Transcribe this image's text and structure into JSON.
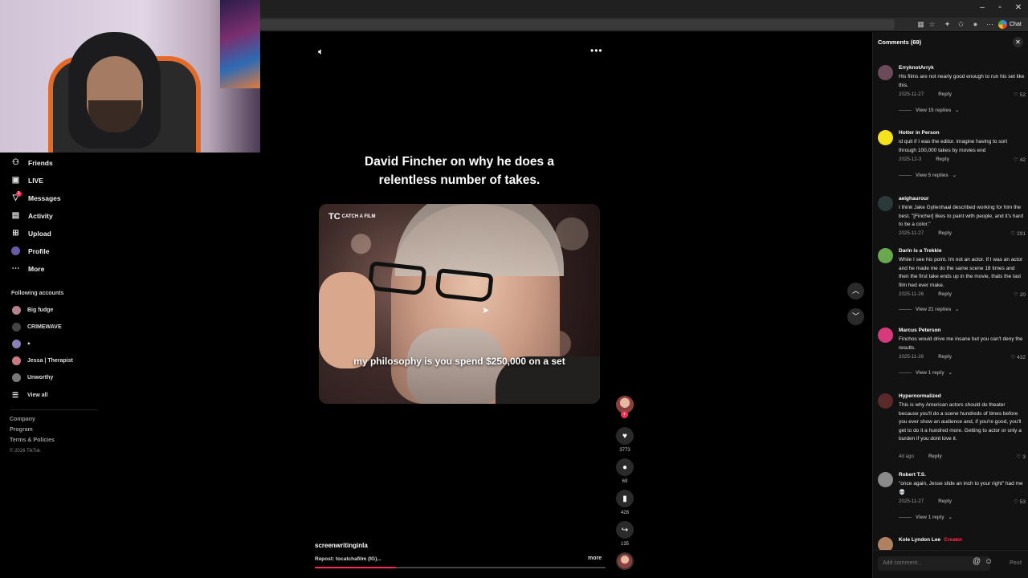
{
  "browser": {
    "chat_label": "Chat",
    "window_controls": [
      "–",
      "▫",
      "✕"
    ]
  },
  "sidebar": {
    "nav": [
      {
        "label": "Friends",
        "icon": "friends-icon"
      },
      {
        "label": "LIVE",
        "icon": "live-icon"
      },
      {
        "label": "Messages",
        "icon": "messages-icon"
      },
      {
        "label": "Activity",
        "icon": "activity-icon"
      },
      {
        "label": "Upload",
        "icon": "upload-icon"
      },
      {
        "label": "Profile",
        "icon": "avatar"
      },
      {
        "label": "More",
        "icon": "more-icon"
      }
    ],
    "messages_badge": "1",
    "following_title": "Following accounts",
    "following": [
      {
        "name": "Big fudge",
        "color": "#b5838d"
      },
      {
        "name": "CRIMEWAVE",
        "color": "#444444"
      },
      {
        "name": "⭑",
        "color": "#8a7fb8"
      },
      {
        "name": "Jessa | Therapist",
        "color": "#c97b84"
      },
      {
        "name": "Unworthy",
        "color": "#777777"
      }
    ],
    "view_all": "View all",
    "footer_links": [
      "Company",
      "Program",
      "Terms & Policies"
    ],
    "copyright": "© 2026 TikTok"
  },
  "video": {
    "headline": "David Fincher on why he does a relentless number of takes.",
    "watermark_big": "TC",
    "watermark_small": "CATCH A FILM",
    "subtitle": "my philosophy is you spend $250,000 on a set",
    "username": "screenwritinginla",
    "caption": "Repost: tocatchafilm (IG)...",
    "more": "more",
    "progress_fraction": 0.28
  },
  "actions": {
    "likes": "3773",
    "comments": "69",
    "saves": "428",
    "shares": "135"
  },
  "comments_panel": {
    "title": "Comments (69)",
    "input_placeholder": "Add comment...",
    "post_label": "Post",
    "reply_label": "Reply",
    "comments": [
      {
        "user": "ErryknotArryk",
        "text": "His films are not nearly good enough to run his set like this.",
        "date": "2025-11-27",
        "likes": "52",
        "replies": "View 15 replies",
        "color": "#6b4a5a"
      },
      {
        "user": "Hotter in Person",
        "text": "id quit if I was the editor. imagine having to sort through 100,000 takes by movies end",
        "date": "2025-12-3",
        "likes": "42",
        "replies": "View 5 replies",
        "color": "#f4e21a"
      },
      {
        "user": "aeighaurour",
        "text": "I think Jake Gyllenhaal described working for him the best. \"[Fincher] likes to paint with people, and it's hard to be a color.\"",
        "date": "2025-11-27",
        "likes": "291",
        "replies": "",
        "color": "#2a3a3a"
      },
      {
        "user": "Darin is a Trekkie",
        "text": "While I see his point. Im not an actor. If I was an actor and he made me do the same scene 18 times and then the first take ends up in the movie, thats the last film hed ever make.",
        "date": "2025-11-26",
        "likes": "20",
        "replies": "View 21 replies",
        "color": "#6aa84f"
      },
      {
        "user": "Marcus Peterson",
        "text": "Finchos would drive me insane but you can't deny the results.",
        "date": "2025-11-26",
        "likes": "432",
        "replies": "View 1 reply",
        "color": "#d63a7a"
      },
      {
        "user": "Hypernormalized",
        "text": "This is why American actors should do theater because you'll do a scene hundreds of times before you ever show an audience and, if you're good, you'll get to do it a hundred more. Getting to actor or only a burden if you dont love it.",
        "date": "4d ago",
        "likes": "3",
        "replies": "",
        "color": "#5a2a2a"
      },
      {
        "user": "Robert T.S.",
        "text": "\"once again, Jesse slide an inch to your right\" had me 💀",
        "date": "2025-11-27",
        "likes": "53",
        "replies": "View 1 reply",
        "color": "#8a8a8a"
      },
      {
        "user": "Kole Lyndon Lee",
        "text": "",
        "date": "",
        "likes": "",
        "replies": "",
        "color": "#b08060",
        "creator": "Creator"
      }
    ]
  }
}
